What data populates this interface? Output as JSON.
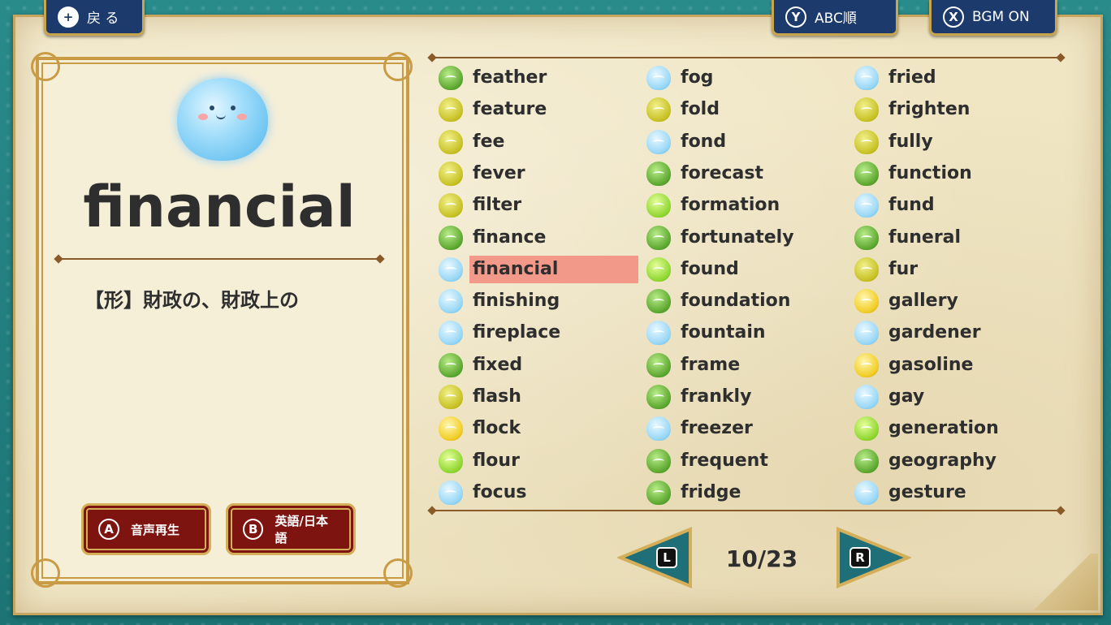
{
  "top_buttons": {
    "back": {
      "key": "+",
      "label": "戻 る"
    },
    "sort": {
      "key": "Y",
      "label": "ABC順"
    },
    "bgm": {
      "key": "X",
      "label": "BGM ON"
    }
  },
  "card": {
    "word": "financial",
    "meaning": "【形】財政の、財政上の",
    "play_audio": {
      "key": "A",
      "label": "音声再生"
    },
    "toggle_lang": {
      "key": "B",
      "label": "英語/日本語"
    }
  },
  "word_list": {
    "selected": "financial",
    "columns": [
      [
        {
          "word": "feather",
          "color": "green"
        },
        {
          "word": "feature",
          "color": "olive"
        },
        {
          "word": "fee",
          "color": "olive"
        },
        {
          "word": "fever",
          "color": "olive"
        },
        {
          "word": "filter",
          "color": "olive"
        },
        {
          "word": "finance",
          "color": "green"
        },
        {
          "word": "financial",
          "color": "blue"
        },
        {
          "word": "finishing",
          "color": "blue"
        },
        {
          "word": "fireplace",
          "color": "blue"
        },
        {
          "word": "fixed",
          "color": "green"
        },
        {
          "word": "flash",
          "color": "olive"
        },
        {
          "word": "flock",
          "color": "gold"
        },
        {
          "word": "flour",
          "color": "lime"
        },
        {
          "word": "focus",
          "color": "blue"
        }
      ],
      [
        {
          "word": "fog",
          "color": "blue"
        },
        {
          "word": "fold",
          "color": "olive"
        },
        {
          "word": "fond",
          "color": "blue"
        },
        {
          "word": "forecast",
          "color": "green"
        },
        {
          "word": "formation",
          "color": "lime"
        },
        {
          "word": "fortunately",
          "color": "green"
        },
        {
          "word": "found",
          "color": "lime"
        },
        {
          "word": "foundation",
          "color": "green"
        },
        {
          "word": "fountain",
          "color": "blue"
        },
        {
          "word": "frame",
          "color": "green"
        },
        {
          "word": "frankly",
          "color": "green"
        },
        {
          "word": "freezer",
          "color": "blue"
        },
        {
          "word": "frequent",
          "color": "green"
        },
        {
          "word": "fridge",
          "color": "green"
        }
      ],
      [
        {
          "word": "fried",
          "color": "blue"
        },
        {
          "word": "frighten",
          "color": "olive"
        },
        {
          "word": "fully",
          "color": "olive"
        },
        {
          "word": "function",
          "color": "green"
        },
        {
          "word": "fund",
          "color": "blue"
        },
        {
          "word": "funeral",
          "color": "green"
        },
        {
          "word": "fur",
          "color": "olive"
        },
        {
          "word": "gallery",
          "color": "gold"
        },
        {
          "word": "gardener",
          "color": "blue"
        },
        {
          "word": "gasoline",
          "color": "gold"
        },
        {
          "word": "gay",
          "color": "blue"
        },
        {
          "word": "generation",
          "color": "lime"
        },
        {
          "word": "geography",
          "color": "green"
        },
        {
          "word": "gesture",
          "color": "blue"
        }
      ]
    ]
  },
  "pager": {
    "prev_key": "L",
    "next_key": "R",
    "page_text": "10/23"
  },
  "colors": {
    "frame": "#1f7f80",
    "paper": "#f0e6c4",
    "gold": "#c99b45",
    "button_blue": "#1c3a6b",
    "button_red": "#7e1410",
    "selection": "#f2998a",
    "pager_teal": "#1f6f78"
  }
}
